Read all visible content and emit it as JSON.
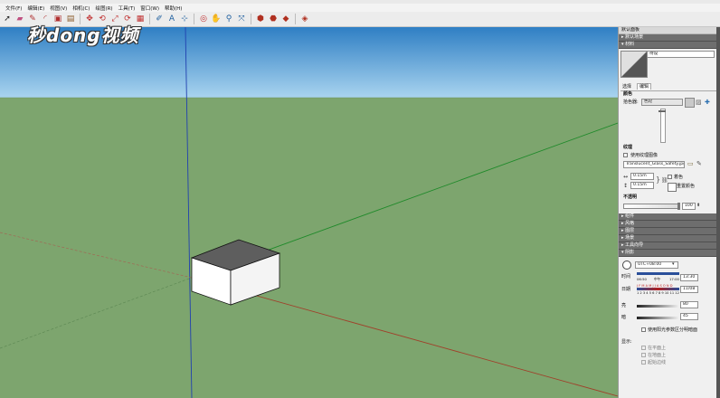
{
  "window": {
    "title": ""
  },
  "menu": [
    "文件(F)",
    "编辑(E)",
    "视图(V)",
    "相机(C)",
    "绘图(R)",
    "工具(T)",
    "窗口(W)",
    "帮助(H)"
  ],
  "watermark": "秒dong视频",
  "toolbar_icons": [
    "select-arrow-icon",
    "eraser-icon",
    "line-tool-icon",
    "arc-tool-icon",
    "shape-tool-icon",
    "push-pull-icon",
    "move-icon",
    "rotate-icon",
    "scale-icon",
    "offset-icon",
    "tape-measure-icon",
    "text-icon",
    "axes-icon",
    "dimension-icon",
    "orbit-icon",
    "pan-icon",
    "zoom-icon",
    "zoom-extents-icon",
    "warehouse-icon",
    "extension-icon",
    "ruby-icon",
    "section-icon"
  ],
  "panel": {
    "tray_title": "默认面板",
    "scenes_header": "▸ 默认面板",
    "header_scenes": "▸ 默认场景",
    "header_materials": "▾ 材料",
    "material_name": "待设",
    "tabs": {
      "select": "选择",
      "edit": "编辑"
    },
    "color_section": "颜色",
    "picker_label": "拾色器:",
    "picker_value": "色轮",
    "texture_section": "纹理",
    "use_texture_label": "使用纹理图像",
    "texture_file": "Translucent_Glass_Safety.jpg",
    "width_value": "0.15m",
    "height_value": "0.15m",
    "colorize_label": "着色",
    "reset_color_label": "重置颜色",
    "opacity_section": "不透明",
    "opacity_value": "100",
    "collapsed_headers": [
      "▸ 组件",
      "▸ 风格",
      "▸ 图层",
      "▸ 场景",
      "▸ 工具向导"
    ],
    "shadows_header": "▾ 阴影",
    "timezone": "UTC+08:00",
    "time_label": "时间",
    "time_start": "06:50",
    "time_noon": "中午",
    "time_end": "17:00",
    "time_value": "13:30",
    "date_label": "日期",
    "months": "J F M A M J J A S O N D",
    "months_numbers": "1 2 3 4 5 6 7 8 9 10 11 12",
    "date_value": "11/08",
    "light_label": "亮",
    "light_value": "80",
    "dark_label": "暗",
    "dark_value": "45",
    "sun_shading_label": "使用阳光参数区分明暗面",
    "display_label": "显示:",
    "on_faces_label": "在平面上",
    "on_ground_label": "在地面上",
    "from_edges_label": "起始边线"
  }
}
